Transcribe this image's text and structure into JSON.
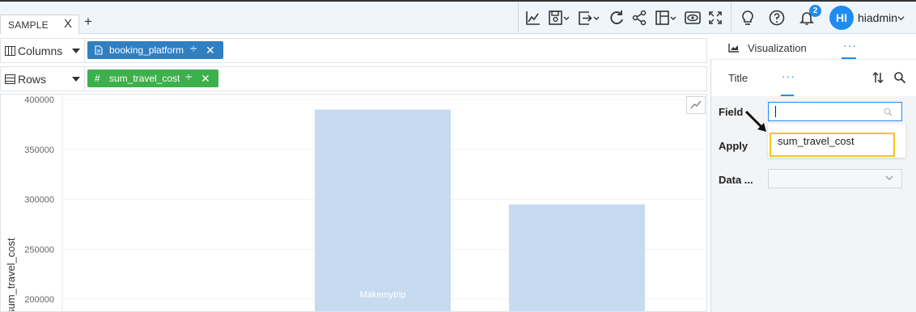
{
  "topbar": {
    "tab_label": "SAMPLE",
    "close_glyph": "X",
    "add_glyph": "+",
    "notification_count": "2",
    "avatar_initials": "HI",
    "username": "hiadmin",
    "icons": [
      "line-chart-icon",
      "save-icon",
      "export-icon",
      "refresh-icon",
      "share-icon",
      "layout-icon",
      "preview-icon",
      "fullscreen-icon",
      "bulb-icon",
      "help-icon",
      "bell-icon"
    ]
  },
  "shelves": {
    "columns": {
      "label": "Columns",
      "pill": "booking_platform",
      "pill_color": "#2f7fc1"
    },
    "rows": {
      "label": "Rows",
      "pill": "sum_travel_cost",
      "pill_color": "#3cb04a"
    }
  },
  "chart_data": {
    "type": "bar",
    "categories": [
      "",
      "Makemytrip",
      ""
    ],
    "values": [
      null,
      390000,
      295000
    ],
    "ylabel": "sum_travel_cost",
    "yticks": [
      "400000",
      "350000",
      "300000",
      "250000",
      "200000"
    ],
    "visible_ylim": [
      188000,
      405000
    ],
    "bar_color": "#c7dbf0",
    "category_label_visible": "Makemytrip"
  },
  "panel": {
    "visualization_label": "Visualization",
    "more_glyph": "···",
    "title_tab": "Title",
    "dots_tab": "···",
    "field_label": "Field",
    "apply_label": "Apply",
    "data_label": "Data ...",
    "field_option": "sum_travel_cost",
    "accent": "#1f8cf0",
    "highlight_color": "#f5c518"
  }
}
